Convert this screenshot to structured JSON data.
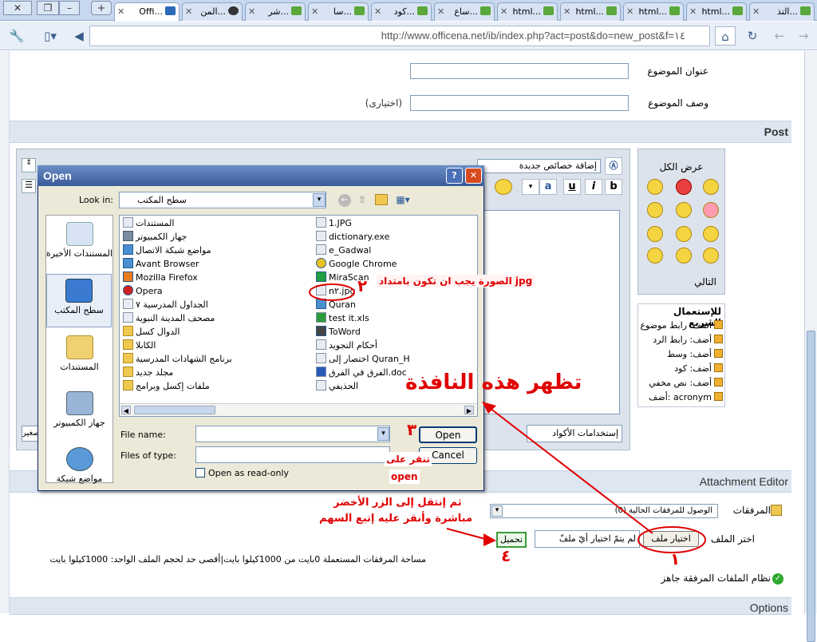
{
  "tabs": [
    {
      "label": "التذ..."
    },
    {
      "label": "html..."
    },
    {
      "label": "html..."
    },
    {
      "label": "html..."
    },
    {
      "label": "html..."
    },
    {
      "label": "ساع..."
    },
    {
      "label": "كود..."
    },
    {
      "label": "سا..."
    },
    {
      "label": "شر..."
    },
    {
      "label": "المن..."
    },
    {
      "label": "Offi..."
    }
  ],
  "toolbar": {
    "url": "http://www.officena.net/ib/index.php?act=post&do=new_post&f=١٤"
  },
  "form": {
    "title_label": "عنوان الموضوع",
    "desc_label": "وصف الموضوع",
    "optional_text": "(اختيارى)",
    "post_header": "Post",
    "show_all": "عرض الكل",
    "next": "التالي",
    "quick_title": "للإستعمال السريع",
    "quick_items": [
      "أضف: رابط موضوع",
      "أضف: رابط الرد",
      "أضف: وسط",
      "أضف: كود",
      "أضف: نص مخفي",
      "أضف: acronym"
    ],
    "add_props": "إضافة خصائص جديدة",
    "tags_hint": "إستخدامات الأكواد",
    "small_label": "صغير",
    "attach_header": "Attachment Editor",
    "attach_label": "المرفقات",
    "attach_select": "الوصول للمرفقات الحالية (0)",
    "choose_file_label": "اختر الملف",
    "choose_file_btn": "اختيار ملف",
    "no_file": "لم يتمّ اختيار أيّ ملفّ",
    "upload_btn": "تحميل",
    "space_text": "مساحة المرفقات المستعملة 0بايت من 1000كيلوا بايت|أقصى حد لحجم الملف الواحد: 1000كيلوا بايت",
    "system_ready": "نظام الملفات المرفقة جاهز",
    "options_header": "Options"
  },
  "dialog": {
    "title": "Open",
    "look_in_label": "Look in:",
    "look_in_value": "سطح المكتب",
    "places": [
      "المستندات الأخيرة",
      "سطح المكتب",
      "المستندات",
      "جهاز الكمبيوتر",
      "مواضع شبكة"
    ],
    "left_files": [
      "المستندات",
      "جهاز الكمبيوتر",
      "مواضع شبكة الاتصال",
      "Avant Browser",
      "Mozilla Firefox",
      "Opera",
      "الجداول المدرسية ٧",
      "مصحف المدينة النبوية",
      "الدوال كسل",
      "الكابلا",
      "برنامج الشهادات المدرسية",
      "مجلد جديد",
      "ملفات إكسل وبرامج"
    ],
    "right_files": [
      "1.JPG",
      "dictionary.exe",
      "e_Gadwal",
      "Google Chrome",
      "MiraScan",
      "n٢.jpg",
      "Quran",
      "test it.xls",
      "ToWord",
      "أحكام التجويد",
      "اختصار إلى Quran_H",
      "الفرق في الفرق.doc",
      "الحذيفي"
    ],
    "filename_label": "File name:",
    "filetype_label": "Files of type:",
    "readonly_label": "Open as read-only",
    "open_btn": "Open",
    "cancel_btn": "Cancel"
  },
  "annotations": {
    "window_appears": "تظهر هذه النافذة",
    "jpg_note": "الصورة يجب ان تكون بامتداد jpg",
    "num2": "٢",
    "num3": "٣",
    "click_on": "تنقر على",
    "open_word": "open",
    "then_move": "ثم إنتقل إلى الزر الأخضر",
    "then_click": "مباشرة وأنقر عليه إتبع السهم",
    "num1": "١",
    "num4": "٤"
  },
  "colors": {
    "annotation": "#e00000",
    "section_bar": "#dde6f1",
    "dialog_title": "#3a5a98"
  }
}
